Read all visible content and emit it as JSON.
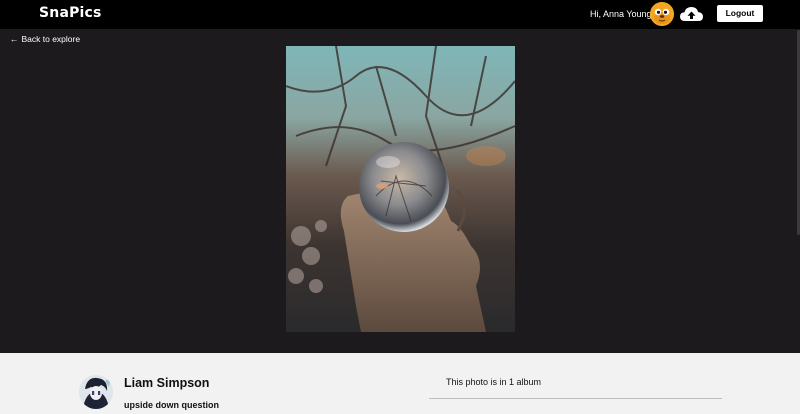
{
  "navbar": {
    "brand": "SnaPics",
    "greeting": "Hi, Anna Young",
    "logout_label": "Logout",
    "upload_icon": "cloud-upload-icon"
  },
  "nav": {
    "back_label": "Back to explore",
    "back_arrow": "←"
  },
  "photo": {
    "alt": "Hand holding crystal ball"
  },
  "details": {
    "author_name": "Liam Simpson",
    "caption": "upside down question",
    "album_info": "This photo is in 1 album"
  },
  "colors": {
    "nav_bg": "#000000",
    "page_bg": "#1c1a1d",
    "panel_bg": "#f2f2f2",
    "avatar_accent": "#f2a623"
  }
}
